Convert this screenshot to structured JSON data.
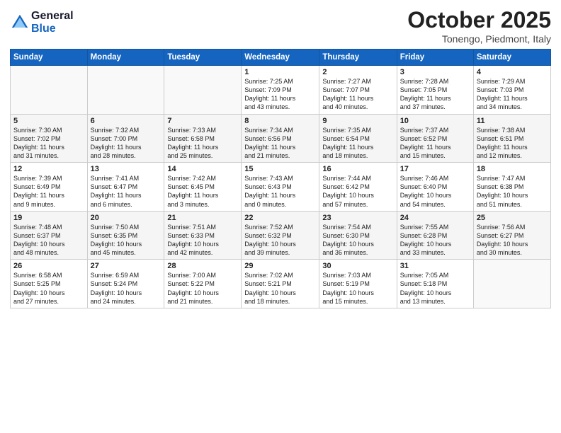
{
  "header": {
    "logo_line1": "General",
    "logo_line2": "Blue",
    "month_title": "October 2025",
    "location": "Tonengo, Piedmont, Italy"
  },
  "weekdays": [
    "Sunday",
    "Monday",
    "Tuesday",
    "Wednesday",
    "Thursday",
    "Friday",
    "Saturday"
  ],
  "weeks": [
    [
      {
        "day": "",
        "content": ""
      },
      {
        "day": "",
        "content": ""
      },
      {
        "day": "",
        "content": ""
      },
      {
        "day": "1",
        "content": "Sunrise: 7:25 AM\nSunset: 7:09 PM\nDaylight: 11 hours\nand 43 minutes."
      },
      {
        "day": "2",
        "content": "Sunrise: 7:27 AM\nSunset: 7:07 PM\nDaylight: 11 hours\nand 40 minutes."
      },
      {
        "day": "3",
        "content": "Sunrise: 7:28 AM\nSunset: 7:05 PM\nDaylight: 11 hours\nand 37 minutes."
      },
      {
        "day": "4",
        "content": "Sunrise: 7:29 AM\nSunset: 7:03 PM\nDaylight: 11 hours\nand 34 minutes."
      }
    ],
    [
      {
        "day": "5",
        "content": "Sunrise: 7:30 AM\nSunset: 7:02 PM\nDaylight: 11 hours\nand 31 minutes."
      },
      {
        "day": "6",
        "content": "Sunrise: 7:32 AM\nSunset: 7:00 PM\nDaylight: 11 hours\nand 28 minutes."
      },
      {
        "day": "7",
        "content": "Sunrise: 7:33 AM\nSunset: 6:58 PM\nDaylight: 11 hours\nand 25 minutes."
      },
      {
        "day": "8",
        "content": "Sunrise: 7:34 AM\nSunset: 6:56 PM\nDaylight: 11 hours\nand 21 minutes."
      },
      {
        "day": "9",
        "content": "Sunrise: 7:35 AM\nSunset: 6:54 PM\nDaylight: 11 hours\nand 18 minutes."
      },
      {
        "day": "10",
        "content": "Sunrise: 7:37 AM\nSunset: 6:52 PM\nDaylight: 11 hours\nand 15 minutes."
      },
      {
        "day": "11",
        "content": "Sunrise: 7:38 AM\nSunset: 6:51 PM\nDaylight: 11 hours\nand 12 minutes."
      }
    ],
    [
      {
        "day": "12",
        "content": "Sunrise: 7:39 AM\nSunset: 6:49 PM\nDaylight: 11 hours\nand 9 minutes."
      },
      {
        "day": "13",
        "content": "Sunrise: 7:41 AM\nSunset: 6:47 PM\nDaylight: 11 hours\nand 6 minutes."
      },
      {
        "day": "14",
        "content": "Sunrise: 7:42 AM\nSunset: 6:45 PM\nDaylight: 11 hours\nand 3 minutes."
      },
      {
        "day": "15",
        "content": "Sunrise: 7:43 AM\nSunset: 6:43 PM\nDaylight: 11 hours\nand 0 minutes."
      },
      {
        "day": "16",
        "content": "Sunrise: 7:44 AM\nSunset: 6:42 PM\nDaylight: 10 hours\nand 57 minutes."
      },
      {
        "day": "17",
        "content": "Sunrise: 7:46 AM\nSunset: 6:40 PM\nDaylight: 10 hours\nand 54 minutes."
      },
      {
        "day": "18",
        "content": "Sunrise: 7:47 AM\nSunset: 6:38 PM\nDaylight: 10 hours\nand 51 minutes."
      }
    ],
    [
      {
        "day": "19",
        "content": "Sunrise: 7:48 AM\nSunset: 6:37 PM\nDaylight: 10 hours\nand 48 minutes."
      },
      {
        "day": "20",
        "content": "Sunrise: 7:50 AM\nSunset: 6:35 PM\nDaylight: 10 hours\nand 45 minutes."
      },
      {
        "day": "21",
        "content": "Sunrise: 7:51 AM\nSunset: 6:33 PM\nDaylight: 10 hours\nand 42 minutes."
      },
      {
        "day": "22",
        "content": "Sunrise: 7:52 AM\nSunset: 6:32 PM\nDaylight: 10 hours\nand 39 minutes."
      },
      {
        "day": "23",
        "content": "Sunrise: 7:54 AM\nSunset: 6:30 PM\nDaylight: 10 hours\nand 36 minutes."
      },
      {
        "day": "24",
        "content": "Sunrise: 7:55 AM\nSunset: 6:28 PM\nDaylight: 10 hours\nand 33 minutes."
      },
      {
        "day": "25",
        "content": "Sunrise: 7:56 AM\nSunset: 6:27 PM\nDaylight: 10 hours\nand 30 minutes."
      }
    ],
    [
      {
        "day": "26",
        "content": "Sunrise: 6:58 AM\nSunset: 5:25 PM\nDaylight: 10 hours\nand 27 minutes."
      },
      {
        "day": "27",
        "content": "Sunrise: 6:59 AM\nSunset: 5:24 PM\nDaylight: 10 hours\nand 24 minutes."
      },
      {
        "day": "28",
        "content": "Sunrise: 7:00 AM\nSunset: 5:22 PM\nDaylight: 10 hours\nand 21 minutes."
      },
      {
        "day": "29",
        "content": "Sunrise: 7:02 AM\nSunset: 5:21 PM\nDaylight: 10 hours\nand 18 minutes."
      },
      {
        "day": "30",
        "content": "Sunrise: 7:03 AM\nSunset: 5:19 PM\nDaylight: 10 hours\nand 15 minutes."
      },
      {
        "day": "31",
        "content": "Sunrise: 7:05 AM\nSunset: 5:18 PM\nDaylight: 10 hours\nand 13 minutes."
      },
      {
        "day": "",
        "content": ""
      }
    ]
  ]
}
